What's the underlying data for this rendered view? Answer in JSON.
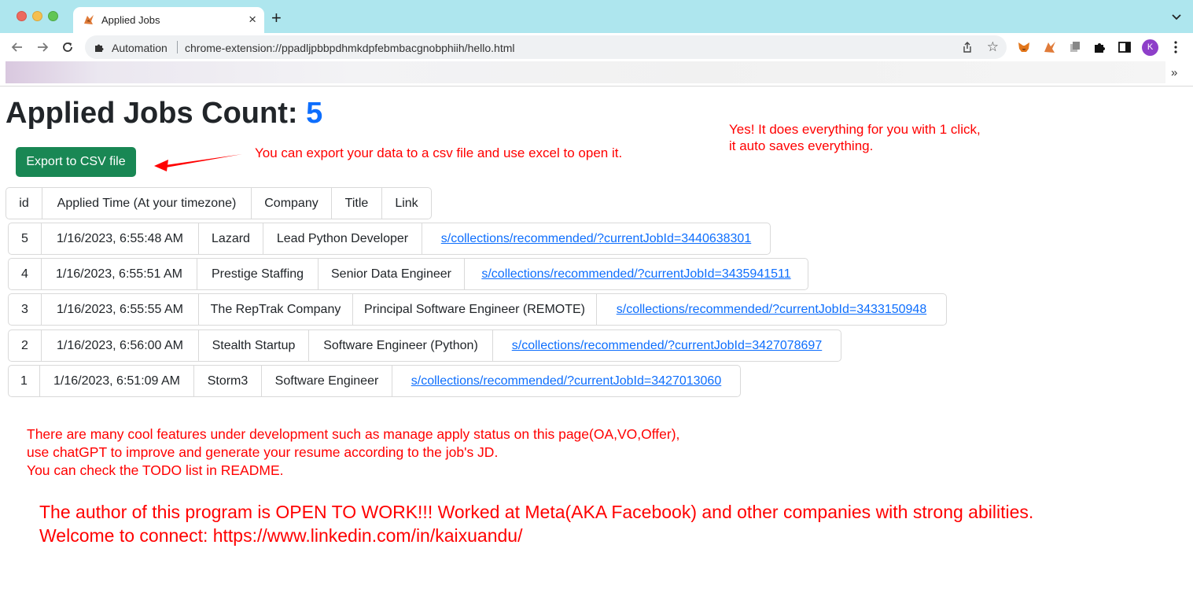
{
  "browser": {
    "tab_title": "Applied Jobs",
    "tab_close": "×",
    "new_tab": "+",
    "omnibox_label": "Automation",
    "url": "chrome-extension://ppadljpbbpdhmkdpfebmbacgnobphiih/hello.html",
    "avatar_letter": "K",
    "bookmarks_more": "»"
  },
  "page": {
    "title_prefix": "Applied Jobs Count: ",
    "count": "5",
    "export_button": "Export to CSV file",
    "export_note": "You can export your data to a csv file and use excel to open it.",
    "click_note_line1": "Yes! It does everything for you with 1 click,",
    "click_note_line2": "it auto saves everything."
  },
  "table": {
    "headers": [
      "id",
      "Applied Time (At your timezone)",
      "Company",
      "Title",
      "Link"
    ],
    "rows": [
      {
        "id": "5",
        "time": "1/16/2023, 6:55:48 AM",
        "company": "Lazard",
        "title": "Lead Python Developer",
        "link": "s/collections/recommended/?currentJobId=3440638301"
      },
      {
        "id": "4",
        "time": "1/16/2023, 6:55:51 AM",
        "company": "Prestige Staffing",
        "title": "Senior Data Engineer",
        "link": "s/collections/recommended/?currentJobId=3435941511"
      },
      {
        "id": "3",
        "time": "1/16/2023, 6:55:55 AM",
        "company": "The RepTrak Company",
        "title": "Principal Software Engineer (REMOTE)",
        "link": "s/collections/recommended/?currentJobId=3433150948"
      },
      {
        "id": "2",
        "time": "1/16/2023, 6:56:00 AM",
        "company": "Stealth Startup",
        "title": "Software Engineer (Python)",
        "link": "s/collections/recommended/?currentJobId=3427078697"
      },
      {
        "id": "1",
        "time": "1/16/2023, 6:51:09 AM",
        "company": "Storm3",
        "title": "Software Engineer",
        "link": "s/collections/recommended/?currentJobId=3427013060"
      }
    ]
  },
  "notes": {
    "dev_line1": "There are many cool features under development such as manage apply status on this page(OA,VO,Offer),",
    "dev_line2": "use chatGPT to improve and generate your resume according to the job's JD.",
    "dev_line3": "You can check the TODO list in README.",
    "author_line1": "The author of this program is OPEN TO WORK!!! Worked at Meta(AKA Facebook) and other companies with strong abilities.",
    "author_line2": "Welcome to connect: https://www.linkedin.com/in/kaixuandu/"
  },
  "colors": {
    "accent_blue": "#0d6efd",
    "button_green": "#198754",
    "note_red": "#ff0000",
    "titlebar": "#aee6ee"
  }
}
